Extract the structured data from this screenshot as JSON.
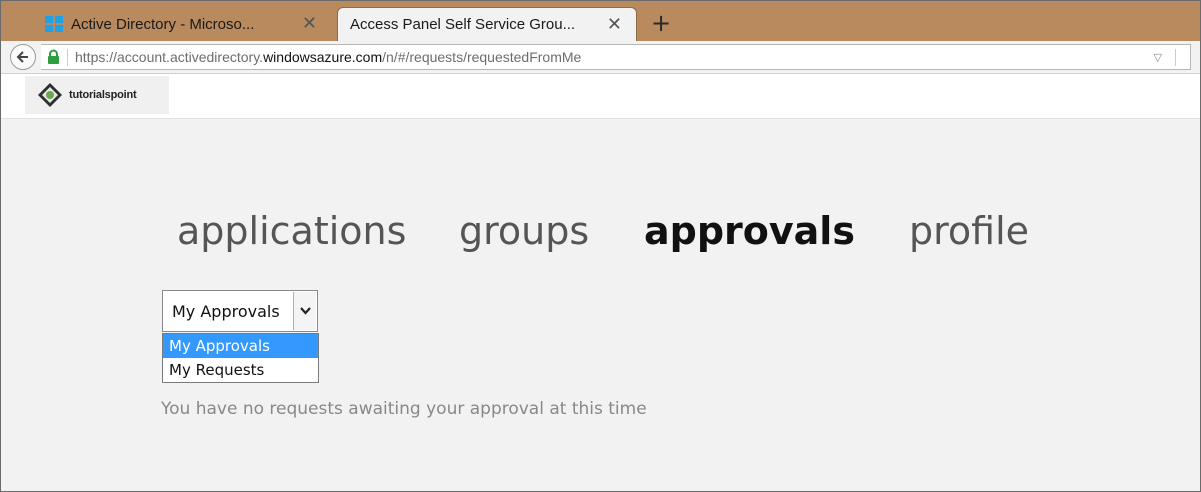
{
  "browser": {
    "tabs": [
      {
        "title": "Active Directory - Microso...",
        "active": false,
        "icon": "windows-logo-icon"
      },
      {
        "title": "Access Panel Self Service Grou...",
        "active": true
      }
    ],
    "new_tab": "+",
    "close_glyph": "✕",
    "url_prefix": "https://account.activedirectory.",
    "url_domain": "windowsazure.com",
    "url_path": "/n/#/requests/requestedFromMe"
  },
  "brand": {
    "logo_text": "tutorialspoint"
  },
  "nav": {
    "items": [
      {
        "label": "applications",
        "active": false
      },
      {
        "label": "groups",
        "active": false
      },
      {
        "label": "approvals",
        "active": true
      },
      {
        "label": "profile",
        "active": false
      }
    ]
  },
  "approvals": {
    "selected": "My Approvals",
    "options": [
      "My Approvals",
      "My Requests"
    ],
    "message": "You have no requests awaiting your approval at this time"
  },
  "colors": {
    "tabstrip": "#b88a5e",
    "selection": "#3399ff",
    "lock": "#2e9e3e"
  }
}
